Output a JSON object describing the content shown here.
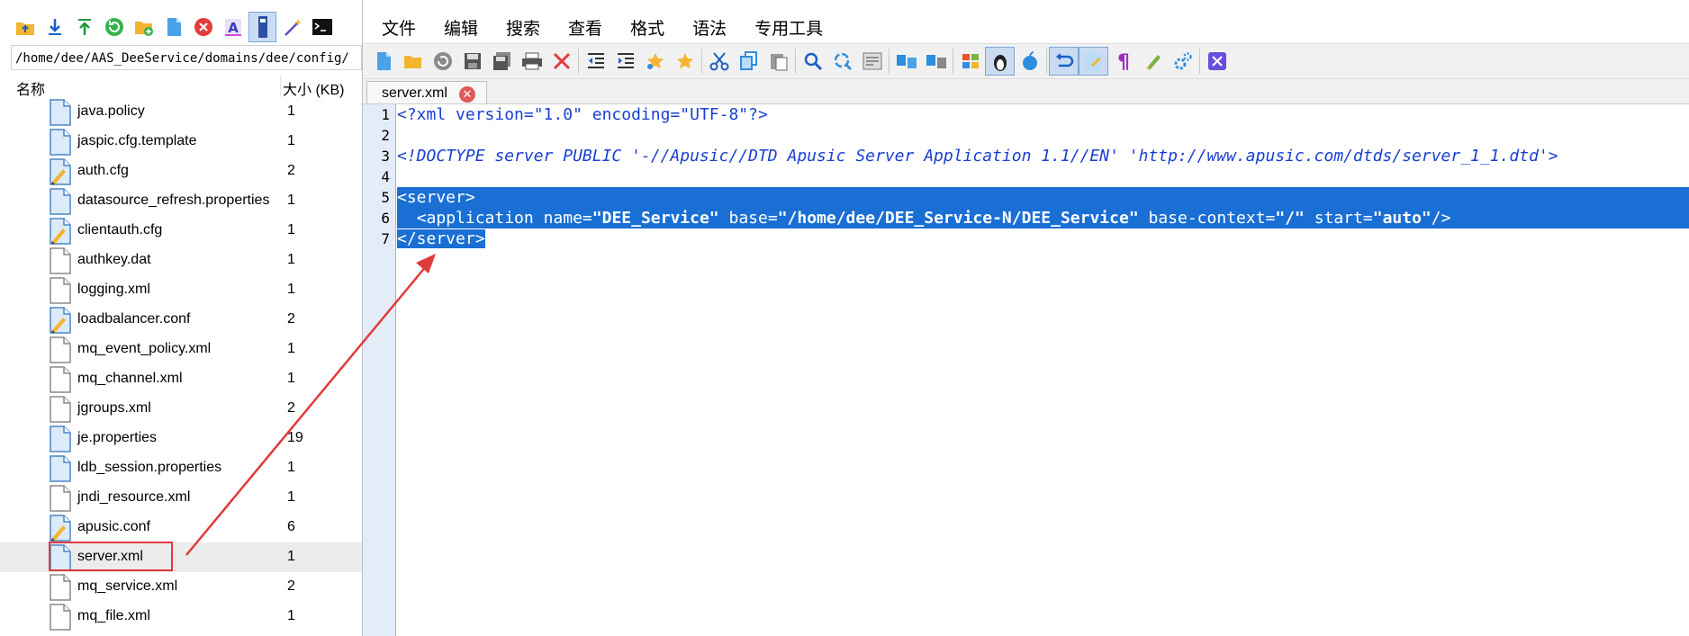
{
  "left_toolbar": {
    "icons": [
      "folder-up-icon",
      "download-icon",
      "upload-icon",
      "refresh-icon",
      "new-folder-icon",
      "new-file-icon",
      "delete-icon",
      "rename-icon",
      "edit-file-icon",
      "magic-wand-icon",
      "terminal-icon"
    ]
  },
  "path": "/home/dee/AAS_DeeService/domains/dee/config/",
  "columns": {
    "name": "名称",
    "size": "大小 (KB)"
  },
  "files": [
    {
      "name": "java.policy",
      "size": "1",
      "icon": "file-icon"
    },
    {
      "name": "jaspic.cfg.template",
      "size": "1",
      "icon": "file-icon"
    },
    {
      "name": "auth.cfg",
      "size": "2",
      "icon": "config-file-icon"
    },
    {
      "name": "datasource_refresh.properties",
      "size": "1",
      "icon": "file-icon"
    },
    {
      "name": "clientauth.cfg",
      "size": "1",
      "icon": "config-file-icon"
    },
    {
      "name": "authkey.dat",
      "size": "1",
      "icon": "blank-file-icon"
    },
    {
      "name": "logging.xml",
      "size": "1",
      "icon": "blank-file-icon"
    },
    {
      "name": "loadbalancer.conf",
      "size": "2",
      "icon": "config-file-icon"
    },
    {
      "name": "mq_event_policy.xml",
      "size": "1",
      "icon": "blank-file-icon"
    },
    {
      "name": "mq_channel.xml",
      "size": "1",
      "icon": "blank-file-icon"
    },
    {
      "name": "jgroups.xml",
      "size": "2",
      "icon": "blank-file-icon"
    },
    {
      "name": "je.properties",
      "size": "19",
      "icon": "file-icon"
    },
    {
      "name": "ldb_session.properties",
      "size": "1",
      "icon": "file-icon"
    },
    {
      "name": "jndi_resource.xml",
      "size": "1",
      "icon": "blank-file-icon"
    },
    {
      "name": "apusic.conf",
      "size": "6",
      "icon": "config-file-icon"
    },
    {
      "name": "server.xml",
      "size": "1",
      "icon": "file-icon"
    },
    {
      "name": "mq_service.xml",
      "size": "2",
      "icon": "blank-file-icon"
    },
    {
      "name": "mq_file.xml",
      "size": "1",
      "icon": "blank-file-icon"
    }
  ],
  "selected_file": "server.xml",
  "menu": [
    "文件",
    "编辑",
    "搜索",
    "查看",
    "格式",
    "语法",
    "专用工具"
  ],
  "editor_toolbar": [
    "new-icon",
    "open-icon",
    "reload-icon",
    "save-icon",
    "save-all-icon",
    "print-icon",
    "close-icon",
    "indent-left-icon",
    "indent-right-icon",
    "bookmark-icon",
    "bookmark-next-icon",
    "cut-icon",
    "copy-icon",
    "paste-icon",
    "find-icon",
    "replace-icon",
    "goto-icon",
    "compare-icon",
    "sync-icon",
    "windows-icon",
    "linux-icon",
    "mac-icon",
    "undo-icon",
    "wrap-icon",
    "paragraph-icon",
    "highlight-icon",
    "settings-icon",
    "exit-icon"
  ],
  "tab": {
    "label": "server.xml"
  },
  "code": {
    "line1": "<?xml version=\"1.0\" encoding=\"UTF-8\"?>",
    "line3": "<!DOCTYPE server PUBLIC '-//Apusic//DTD Apusic Server Application 1.1//EN' 'http://www.apusic.com/dtds/server_1_1.dtd'>",
    "line5": "<server>",
    "line6_indent": "  ",
    "line6_tag_open": "<application",
    "line6_attr1": " name=",
    "line6_val1": "\"DEE_Service\"",
    "line6_attr2": " base=",
    "line6_val2": "\"/home/dee/DEE_Service-N/DEE_Service\"",
    "line6_attr3": " base-context=",
    "line6_val3": "\"/\"",
    "line6_attr4": " start=",
    "line6_val4": "\"auto\"",
    "line6_tag_close": "/>",
    "line7": "</server>"
  },
  "line_numbers": [
    "1",
    "2",
    "3",
    "4",
    "5",
    "6",
    "7"
  ],
  "colors": {
    "selection": "#1a6fd4",
    "keyword": "#1a3fd0",
    "gutter": "#e4ecf8",
    "annotation": "#e03a3a"
  }
}
